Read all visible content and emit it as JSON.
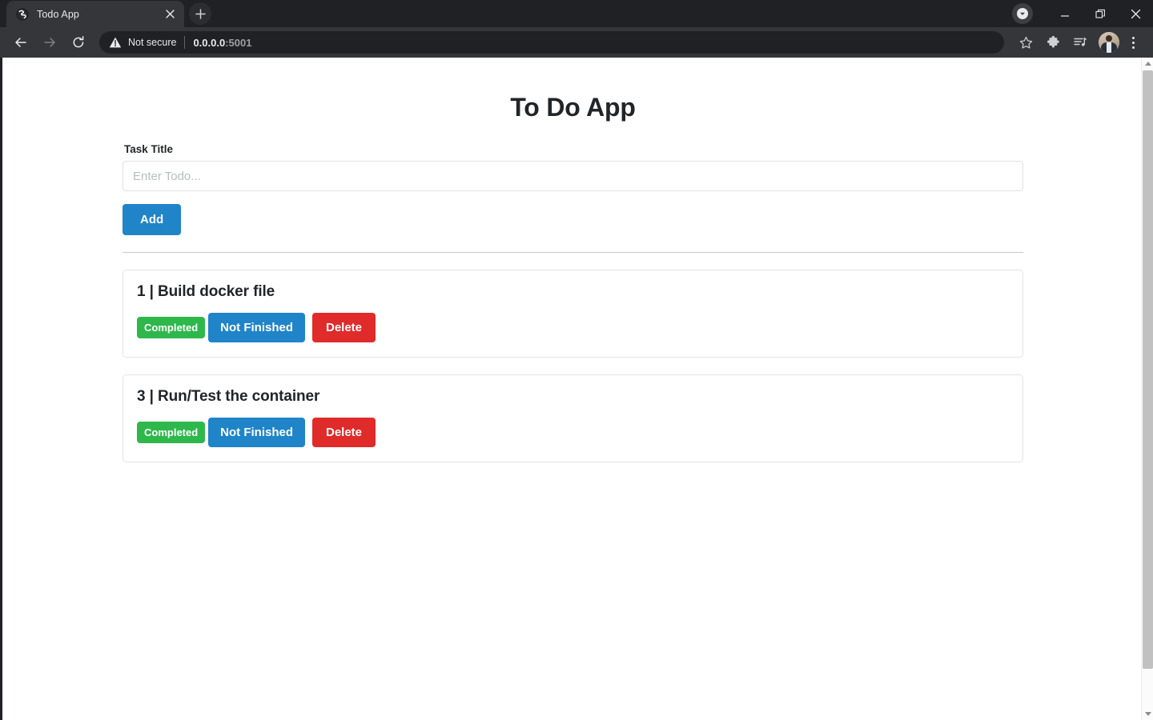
{
  "browser": {
    "tab": {
      "favicon_name": "globe-favicon",
      "title": "Todo App",
      "close_label": "×"
    },
    "new_tab_label": "+",
    "window_controls": {
      "download_label": "▼",
      "minimize_label": "—",
      "restore_label": "❐",
      "close_label": "✕"
    },
    "toolbar": {
      "back_label": "←",
      "forward_label": "→",
      "reload_label": "↻",
      "security_text": "Not secure",
      "url_host": "0.0.0.0",
      "url_port": ":5001",
      "bookmark_label": "☆",
      "extensions_label": "puzzle",
      "media_label": "media",
      "profile_label": "profile",
      "menu_label": "⋮"
    }
  },
  "page": {
    "title": "To Do App",
    "form": {
      "label": "Task Title",
      "input_value": "",
      "input_placeholder": "Enter Todo...",
      "add_label": "Add"
    },
    "actions": {
      "completed_label": "Completed",
      "not_finished_label": "Not Finished",
      "delete_label": "Delete"
    },
    "todos": [
      {
        "id": "1",
        "title": "1 | Build docker file"
      },
      {
        "id": "3",
        "title": "3 | Run/Test the container"
      }
    ]
  },
  "colors": {
    "primary_blue": "#2084c9",
    "success_green": "#2eb84c",
    "danger_red": "#e02b2b",
    "text_dark": "#212529",
    "chrome_dark": "#202124",
    "tab_active": "#35363a"
  },
  "scrollbar": {
    "up_label": "▲",
    "down_label": "▼"
  }
}
